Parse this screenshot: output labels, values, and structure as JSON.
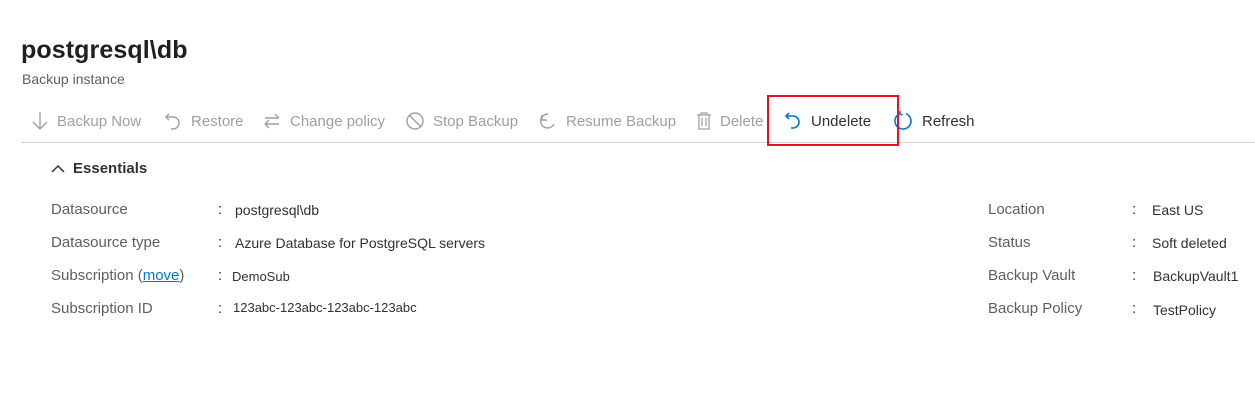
{
  "header": {
    "title": "postgresql\\db",
    "subtitle": "Backup instance"
  },
  "toolbar": {
    "backup_now": "Backup Now",
    "restore": "Restore",
    "change_policy": "Change policy",
    "stop_backup": "Stop Backup",
    "resume_backup": "Resume Backup",
    "delete": "Delete",
    "undelete": "Undelete",
    "refresh": "Refresh"
  },
  "essentials": {
    "toggle_label": "Essentials",
    "left": {
      "datasource_label": "Datasource",
      "datasource_value": "postgresql\\db",
      "datasource_type_label": "Datasource type",
      "datasource_type_value": "Azure Database for PostgreSQL servers",
      "subscription_label": "Subscription (",
      "subscription_move": "move",
      "subscription_close": ")",
      "subscription_value": "DemoSub",
      "subscription_id_label": "Subscription ID",
      "subscription_id_value": "123abc-123abc-123abc-123abc"
    },
    "right": {
      "location_label": "Location",
      "location_value": "East US",
      "status_label": "Status",
      "status_value": "Soft deleted",
      "vault_label": "Backup Vault",
      "vault_value": "BackupVault1",
      "policy_label": "Backup Policy",
      "policy_value": "TestPolicy"
    },
    "colon": ":"
  },
  "colors": {
    "accent": "#0078d4",
    "disabled_text": "#a19f9d",
    "highlight": "#e81123"
  }
}
